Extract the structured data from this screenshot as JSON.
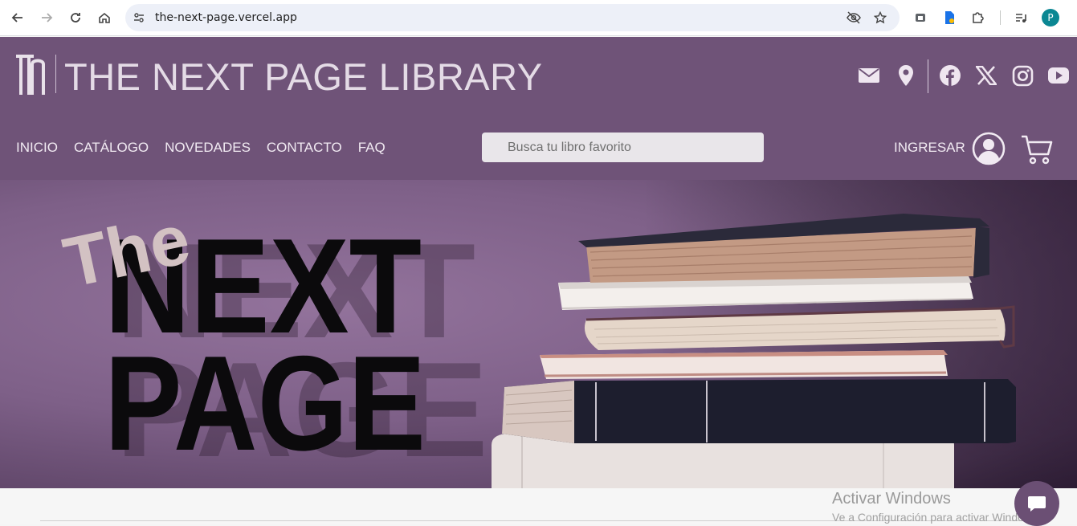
{
  "browser": {
    "url": "the-next-page.vercel.app",
    "profile_initial": "P",
    "icons": [
      "back-icon",
      "forward-icon",
      "reload-icon",
      "home-icon",
      "site-info-icon",
      "eye-off-icon",
      "star-icon",
      "extension-icon",
      "puzzle-icon",
      "media-icon"
    ]
  },
  "header": {
    "brand": "THE NEXT PAGE LIBRARY",
    "social": [
      "mail-icon",
      "location-icon",
      "facebook-icon",
      "x-icon",
      "instagram-icon",
      "youtube-icon"
    ],
    "menu": [
      "INICIO",
      "CATÁLOGO",
      "NOVEDADES",
      "CONTACTO",
      "FAQ"
    ],
    "search_placeholder": "Busca tu libro favorito",
    "login_label": "INGRESAR"
  },
  "hero": {
    "the": "The",
    "next": "NEXT",
    "page": "PAGE"
  },
  "watermark": {
    "line1": "Activar Windows",
    "line2": "Ve a Configuración para activar Windows."
  },
  "colors": {
    "header_bg": "#6f5378",
    "hero_bg": "#7e6088",
    "chat_bg": "#6b4f74"
  }
}
